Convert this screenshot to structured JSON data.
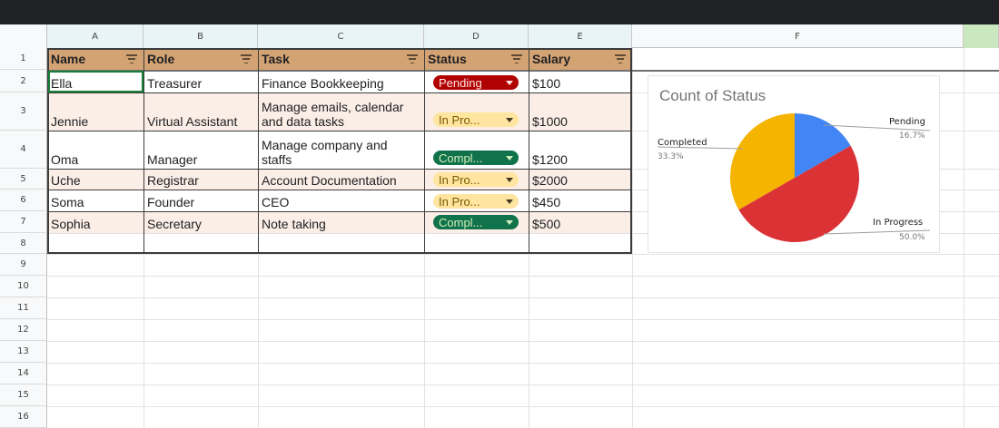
{
  "columns": [
    "A",
    "B",
    "C",
    "D",
    "E",
    "F"
  ],
  "rows": [
    "1",
    "2",
    "3",
    "4",
    "5",
    "6",
    "7",
    "8",
    "9",
    "10",
    "11",
    "12",
    "13",
    "14",
    "15",
    "16"
  ],
  "table": {
    "headers": [
      "Name",
      "Role",
      "Task",
      "Status",
      "Salary"
    ],
    "records": [
      {
        "name": "Ella",
        "role": "Treasurer",
        "task": "Finance Bookkeeping",
        "status": "Pending",
        "salary": "$100"
      },
      {
        "name": "Jennie",
        "role": "Virtual Assistant",
        "task": "Manage emails, calendar and data tasks",
        "status": "In Pro...",
        "salary": "$1000"
      },
      {
        "name": "Oma",
        "role": "Manager",
        "task": "Manage company and staffs",
        "status": "Compl...",
        "salary": "$1200"
      },
      {
        "name": "Uche",
        "role": "Registrar",
        "task": "Account Documentation",
        "status": "In Pro...",
        "salary": "$2000"
      },
      {
        "name": "Soma",
        "role": "Founder",
        "task": "CEO",
        "status": "In Pro...",
        "salary": "$450"
      },
      {
        "name": "Sophia",
        "role": "Secretary",
        "task": "Note taking",
        "status": "Compl...",
        "salary": "$500"
      }
    ]
  },
  "status_colors": {
    "Pending": "#b10202",
    "In Progress": "#ffe5a0",
    "Completed": "#11734b"
  },
  "chart_data": {
    "type": "pie",
    "title": "Count of Status",
    "slices": [
      {
        "label": "Pending",
        "value": 16.7,
        "display": "16.7%",
        "color": "#4285f4"
      },
      {
        "label": "In Progress",
        "value": 50.0,
        "display": "50.0%",
        "color": "#db3236"
      },
      {
        "label": "Completed",
        "value": 33.3,
        "display": "33.3%",
        "color": "#f4b400"
      }
    ]
  }
}
